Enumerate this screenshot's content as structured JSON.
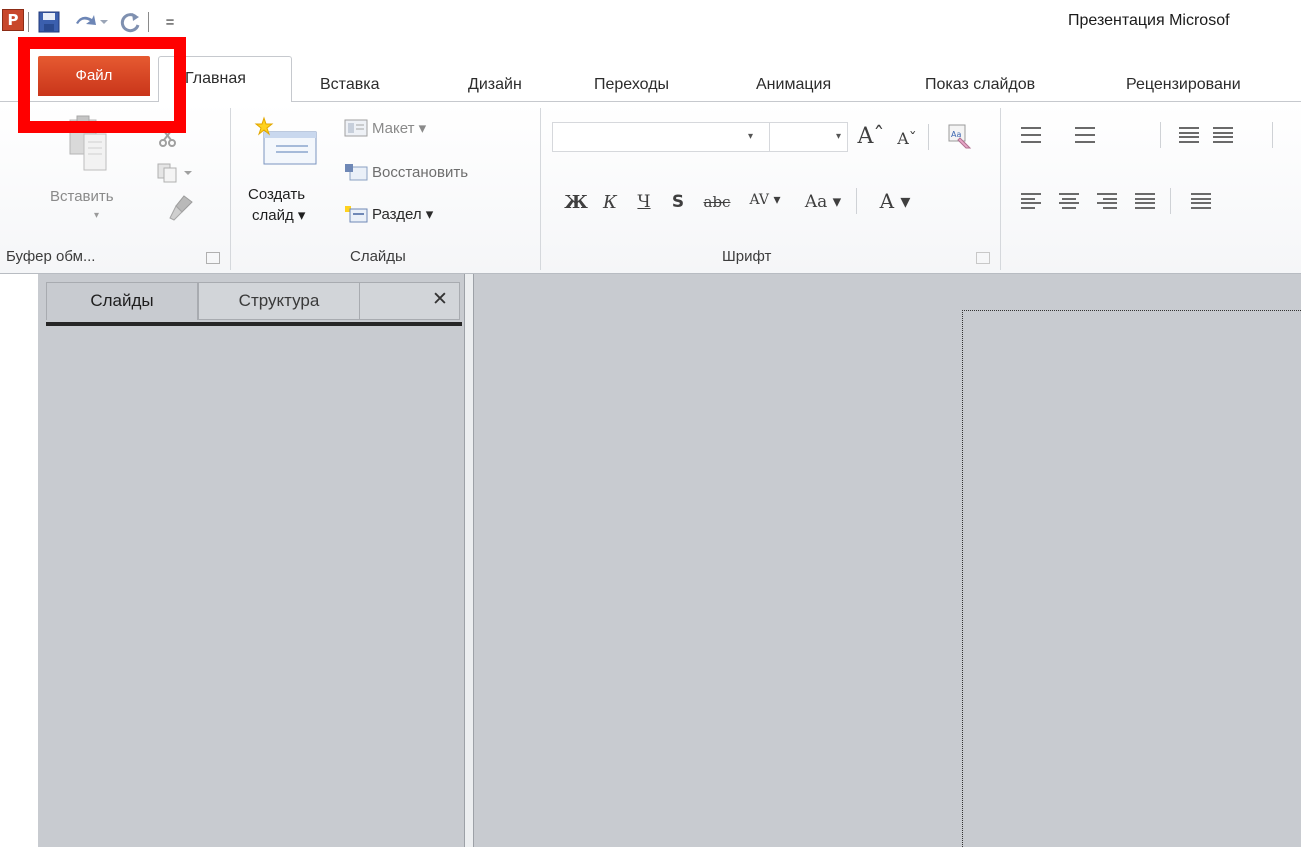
{
  "title_bar": {
    "app_logo": "P",
    "qa_separator": "|",
    "custom_icon": "=",
    "window_title": "Презентация Microsof"
  },
  "tabs": {
    "file": "Файл",
    "home": "Главная",
    "insert": "Вставка",
    "design": "Дизайн",
    "transitions": "Переходы",
    "animation": "Анимация",
    "slideshow": "Показ слайдов",
    "review": "Рецензировани"
  },
  "highlight": {
    "color": "#ff0000",
    "target": "Файл"
  },
  "ribbon": {
    "clipboard": {
      "group_label": "Буфер обм...",
      "paste_label": "Вставить",
      "paste_arrow": "▾"
    },
    "slides": {
      "group_label": "Слайды",
      "new_slide_line1": "Создать",
      "new_slide_line2": "слайд ▾",
      "layout": "Макет ▾",
      "reset": "Восстановить",
      "section": "Раздел ▾"
    },
    "font": {
      "group_label": "Шрифт",
      "font_name": "",
      "font_size": "",
      "dropdown_arrow": "▾",
      "grow": "Aˆ",
      "shrink": "Aˇ",
      "bold": "Ж",
      "italic": "К",
      "underline": "Ч",
      "shadow": "S",
      "strikethrough": "abc",
      "char_spacing": "AV ▾",
      "change_case": "Aa ▾",
      "font_color": "A ▾"
    }
  },
  "left_pane": {
    "tab_slides": "Слайды",
    "tab_outline": "Структура",
    "close": "✕"
  },
  "colors": {
    "file_tab": "#d4401f",
    "pane_background": "#c8cbd0",
    "highlight_box": "#ff0000"
  }
}
